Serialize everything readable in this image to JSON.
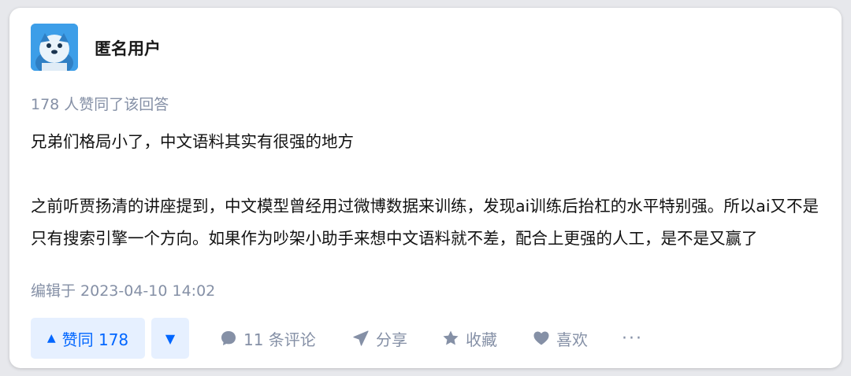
{
  "author": {
    "name": "匿名用户",
    "avatar_icon": "anonymous-bird-avatar"
  },
  "answer": {
    "upvote_summary": "178 人赞同了该回答",
    "paragraphs": [
      "兄弟们格局小了，中文语料其实有很强的地方",
      "之前听贾扬清的讲座提到，中文模型曾经用过微博数据来训练，发现ai训练后抬杠的水平特别强。所以ai又不是只有搜索引擎一个方向。如果作为吵架小助手来想中文语料就不差，配合上更强的人工，是不是又赢了"
    ],
    "edited": "编辑于 2023-04-10 14:02"
  },
  "actions": {
    "upvote_label": "赞同 178",
    "upvote_icon": "triangle-up-icon",
    "downvote_icon": "triangle-down-icon",
    "comments_label": "11 条评论",
    "share_label": "分享",
    "collect_label": "收藏",
    "like_label": "喜欢",
    "more_label": "···"
  },
  "colors": {
    "accent": "#0066ff",
    "accent_bg": "#e6f0ff",
    "muted": "#8590a6",
    "text": "#121212",
    "avatar_bg": "#3d9ee8"
  }
}
